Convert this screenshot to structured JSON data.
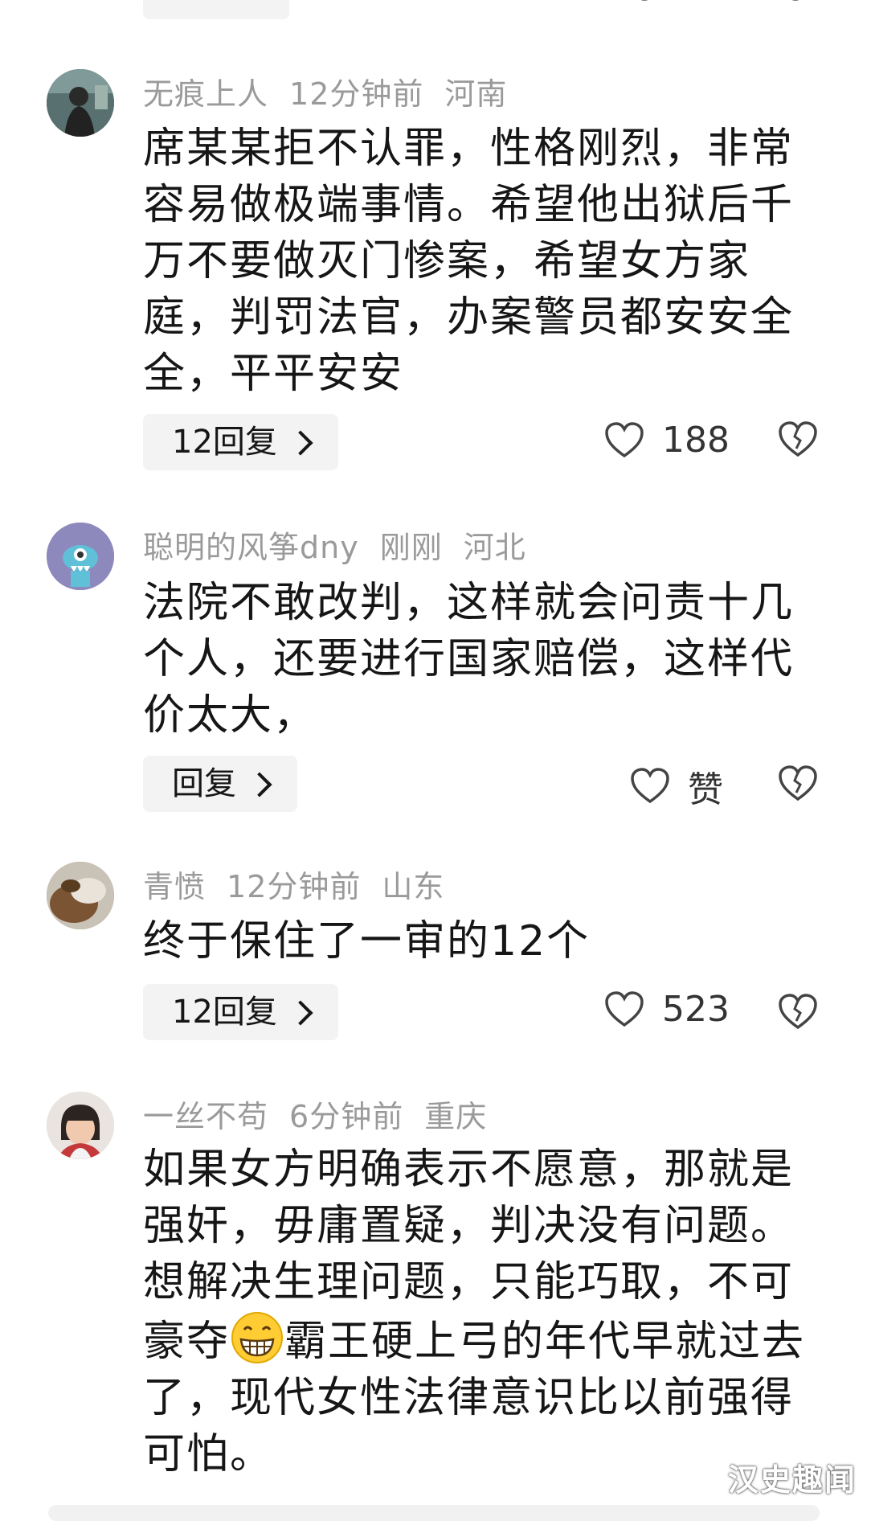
{
  "comments": [
    {
      "username": "无痕上人",
      "time": "12分钟前",
      "location": "河南",
      "text": "席某某拒不认罪，性格刚烈，非常容易做极端事情。希望他出狱后千万不要做灭门惨案，希望女方家庭，判罚法官，办案警员都安安全全，平平安安",
      "reply_label": "12回复",
      "likes": "188",
      "avatar_color": "#3d4a4a"
    },
    {
      "username": "聪明的风筝dny",
      "time": "刚刚",
      "location": "河北",
      "text": "法院不敢改判，这样就会问责十几个人，还要进行国家赔偿，这样代价太大，",
      "reply_label": "回复",
      "likes": "赞",
      "avatar_color": "#8a86b8"
    },
    {
      "username": "青愤",
      "time": "12分钟前",
      "location": "山东",
      "text": "终于保住了一审的12个",
      "reply_label": "12回复",
      "likes": "523",
      "avatar_color": "#6b4f33"
    },
    {
      "username": "一丝不苟",
      "time": "6分钟前",
      "location": "重庆",
      "text_before_emoji": "如果女方明确表示不愿意，那就是强奸，毋庸置疑，判决没有问题。想解决生理问题，只能巧取，不可豪夺",
      "emoji": "grinning-emoji",
      "text_after_emoji": "霸王硬上弓的年代早就过去了，现代女性法律意识比以前强得可怕。",
      "avatar_color": "#d9c7b8"
    }
  ],
  "watermark": "汉史趣闻"
}
